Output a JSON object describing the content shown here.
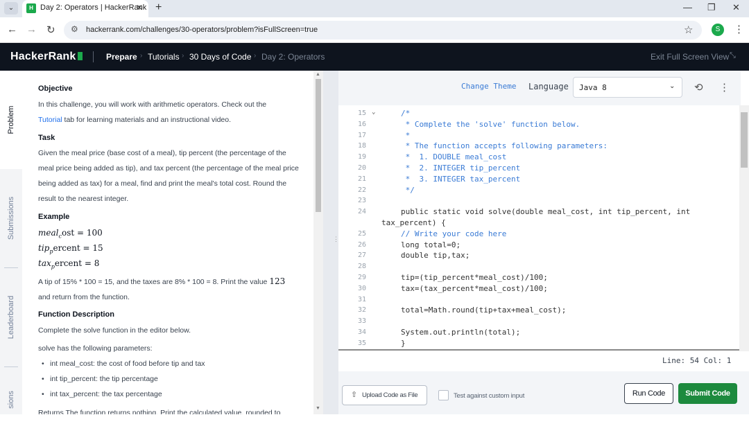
{
  "browser": {
    "tab_title": "Day 2: Operators | HackerRank",
    "url": "hackerrank.com/challenges/30-operators/problem?isFullScreen=true",
    "profile_initial": "S",
    "icons": [
      "chevron-down-icon",
      "close-icon",
      "plus-icon",
      "back-icon",
      "forward-icon",
      "reload-icon",
      "site-info-icon",
      "star-icon",
      "kebab-icon"
    ]
  },
  "header": {
    "logo": "HackerRank",
    "crumbs": [
      "Prepare",
      "Tutorials",
      "30 Days of Code",
      "Day 2: Operators"
    ],
    "exit_label": "Exit Full Screen View"
  },
  "side_tabs": [
    "Problem",
    "Submissions",
    "Leaderboard",
    "sions"
  ],
  "problem": {
    "objective_heading": "Objective",
    "objective_line1": "In this challenge, you will work with arithmetic operators. Check out the",
    "objective_link": "Tutorial",
    "objective_line2": " tab for learning materials and an instructional video.",
    "task_heading": "Task",
    "task_text": "Given the meal price (base cost of a meal), tip percent (the percentage of the meal price being added as tip), and tax percent (the percentage of the meal price being added as tax) for a meal, find and print the meal's total cost. Round the result to the nearest integer.",
    "example_heading": "Example",
    "ex1_var": "meal",
    "ex1_sub": "c",
    "ex1_rest": "ost = 100",
    "ex2_var": "tip",
    "ex2_sub": "p",
    "ex2_rest": "ercent = 15",
    "ex3_var": "tax",
    "ex3_sub": "p",
    "ex3_rest": "ercent = 8",
    "example_text_a": "A tip of 15% * 100 = 15, and the taxes are 8% * 100 = 8. Print the value ",
    "example_value": "123",
    "example_text_b": "and return from the function.",
    "fd_heading": "Function Description",
    "fd_text": "Complete the solve function in the editor below.",
    "params_intro": "solve has the following parameters:",
    "params": [
      "int meal_cost: the cost of food before tip and tax",
      "int tip_percent: the tip percentage",
      "int tax_percent: the tax percentage"
    ],
    "returns_partial": "Returns The function returns nothing. Print the calculated value, rounded to"
  },
  "editor": {
    "change_theme": "Change Theme",
    "language_label": "Language",
    "language_value": "Java 8",
    "status": "Line: 54 Col: 1",
    "lines": [
      {
        "n": "15",
        "text": "/*",
        "kind": "comment",
        "indent": 0,
        "fold": true
      },
      {
        "n": "16",
        "text": " * Complete the 'solve' function below.",
        "kind": "comment",
        "indent": 0
      },
      {
        "n": "17",
        "text": " *",
        "kind": "comment",
        "indent": 0
      },
      {
        "n": "18",
        "text": " * The function accepts following parameters:",
        "kind": "comment",
        "indent": 0
      },
      {
        "n": "19",
        "text": " *  1. DOUBLE meal_cost",
        "kind": "comment",
        "indent": 0
      },
      {
        "n": "20",
        "text": " *  2. INTEGER tip_percent",
        "kind": "comment",
        "indent": 0
      },
      {
        "n": "21",
        "text": " *  3. INTEGER tax_percent",
        "kind": "comment",
        "indent": 0
      },
      {
        "n": "22",
        "text": " */",
        "kind": "comment",
        "indent": 0
      },
      {
        "n": "23",
        "text": "",
        "kind": "code",
        "indent": 0
      },
      {
        "n": "24",
        "text": "public static void solve(double meal_cost, int tip_percent, int",
        "kind": "code",
        "indent": 0
      },
      {
        "n": "",
        "text": "tax_percent) {",
        "kind": "code",
        "indent": -1
      },
      {
        "n": "25",
        "text": "// Write your code here",
        "kind": "comment",
        "indent": 0
      },
      {
        "n": "26",
        "text": "long total=0;",
        "kind": "code",
        "indent": 0
      },
      {
        "n": "27",
        "text": "double tip,tax;",
        "kind": "code",
        "indent": 0
      },
      {
        "n": "28",
        "text": "",
        "kind": "code",
        "indent": 0
      },
      {
        "n": "29",
        "text": "tip=(tip_percent*meal_cost)/100;",
        "kind": "code",
        "indent": 0
      },
      {
        "n": "30",
        "text": "tax=(tax_percent*meal_cost)/100;",
        "kind": "code",
        "indent": 0
      },
      {
        "n": "31",
        "text": "",
        "kind": "code",
        "indent": 0
      },
      {
        "n": "32",
        "text": "total=Math.round(tip+tax+meal_cost);",
        "kind": "code",
        "indent": 0
      },
      {
        "n": "33",
        "text": "",
        "kind": "code",
        "indent": 0
      },
      {
        "n": "34",
        "text": "System.out.println(total);",
        "kind": "code",
        "indent": 0
      },
      {
        "n": "35",
        "text": "}",
        "kind": "code",
        "indent": 0
      }
    ]
  },
  "footer": {
    "upload_label": "Upload Code as File",
    "custom_input_label": "Test against custom input",
    "run_label": "Run Code",
    "submit_label": "Submit Code"
  },
  "colors": {
    "header_bg": "#0e141e",
    "brand_green": "#1ba94c",
    "submit_green": "#1d8a3e",
    "comment_blue": "#3a7bd5"
  }
}
